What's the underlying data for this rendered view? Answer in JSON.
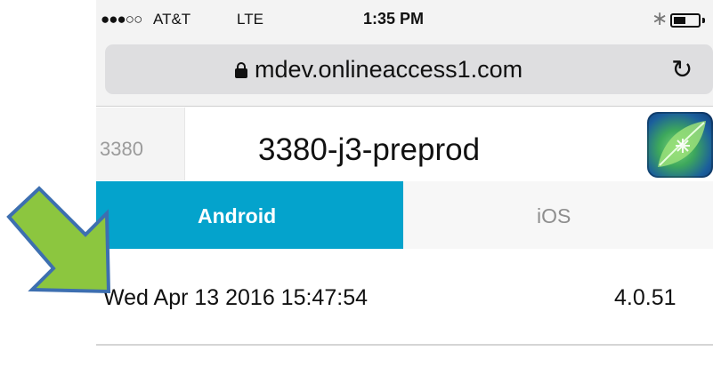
{
  "status_bar": {
    "signal": "●●●○○",
    "carrier": "AT&T",
    "network": "LTE",
    "time": "1:35 PM",
    "bluetooth_icon": "bluetooth-icon",
    "battery_level": 0.4
  },
  "browser": {
    "url": "mdev.onlineaccess1.com",
    "secure_icon": "lock-icon",
    "reload_glyph": "↻"
  },
  "app": {
    "id": "3380",
    "name": "3380-j3-preprod",
    "icon": "leaf-logo-icon"
  },
  "tabs": [
    {
      "label": "Android",
      "active": true
    },
    {
      "label": "iOS",
      "active": false
    }
  ],
  "builds": [
    {
      "date": "Wed Apr 13 2016 15:47:54",
      "version": "4.0.51"
    }
  ],
  "colors": {
    "active_tab": "#04a3cc",
    "arrow_fill": "#8cc63f",
    "arrow_stroke": "#3d6fb0"
  }
}
